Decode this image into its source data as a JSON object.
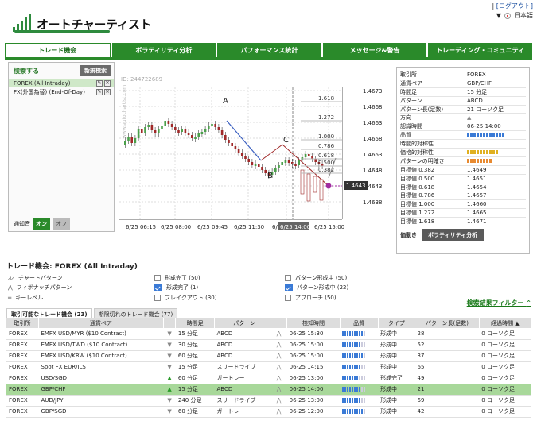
{
  "header": {
    "logo_text": "オートチャーティスト",
    "login_link": "[ログアウト]",
    "language": "日本語",
    "sep": "|"
  },
  "tabs": [
    "トレード機会",
    "ボラティリティ分析",
    "パフォーマンス統計",
    "メッセージ&警告",
    "トレーディング・コミュニティ"
  ],
  "search": {
    "title": "検索する",
    "new_button": "新規検索",
    "items": [
      "FOREX (All Intraday)",
      "FX(外国為替) (End-Of-Day)"
    ],
    "notify_label": "通知音",
    "on": "オン",
    "off": "オフ"
  },
  "chart_id": "ID: 244722689",
  "chart_data": {
    "type": "candlestick",
    "y_ticks": [
      "1.4673",
      "1.4668",
      "1.4663",
      "1.4658",
      "1.4653",
      "1.4648",
      "1.4643",
      "1.4638"
    ],
    "x_ticks": [
      "6/25 06:15",
      "6/25 08:00",
      "6/25 09:45",
      "6/25 11:30",
      "6/25 14:00",
      "6/25 15:00"
    ],
    "current_price": "1.4643",
    "fib_levels": [
      "1.618",
      "1.272",
      "1.000",
      "0.786",
      "0.618",
      "0.500",
      "0.382"
    ],
    "points": [
      "A",
      "B",
      "C"
    ],
    "watermark": "www.autochartist.com"
  },
  "info": {
    "rows": [
      {
        "k": "取引所",
        "v": "FOREX"
      },
      {
        "k": "通貨ペア",
        "v": "GBP/CHF"
      },
      {
        "k": "時間足",
        "v": "15 分足"
      },
      {
        "k": "パターン",
        "v": "ABCD"
      },
      {
        "k": "パターン長(足数)",
        "v": "21 ローソク足"
      },
      {
        "k": "方向",
        "v": "▲"
      },
      {
        "k": "認識時間",
        "v": "06-25 14:00"
      },
      {
        "k": "品質",
        "v": ""
      },
      {
        "k": "時間的対称性",
        "v": ""
      },
      {
        "k": "価格的対称性",
        "v": ""
      },
      {
        "k": "パターンの明確さ",
        "v": ""
      },
      {
        "k": "目標値 0.382",
        "v": "1.4649"
      },
      {
        "k": "目標値 0.500",
        "v": "1.4651"
      },
      {
        "k": "目標値 0.618",
        "v": "1.4654"
      },
      {
        "k": "目標値 0.786",
        "v": "1.4657"
      },
      {
        "k": "目標値 1.000",
        "v": "1.4660"
      },
      {
        "k": "目標値 1.272",
        "v": "1.4665"
      },
      {
        "k": "目標値 1.618",
        "v": "1.4671"
      }
    ],
    "footer_label": "価動き",
    "footer_button": "ボラティリティ分析"
  },
  "opportunities": {
    "title": "トレード機会: FOREX (All Intraday)",
    "legend": [
      "チャートパターン",
      "フィボナッチパターン",
      "キーレベル"
    ],
    "filters": [
      "形成完了 (50)",
      "形成完了 (1)",
      "ブレイクアウト (30)",
      "パターン形成中 (50)",
      "パターン形成中 (22)",
      "アプローチ (50)"
    ],
    "filter_link": "検索結果フィルター",
    "subtabs": [
      "取引可能なトレード機会 (23)",
      "期限切れのトレード機会 (77)"
    ],
    "columns": [
      "取引所",
      "通貨ペア",
      "",
      "時間足",
      "パターン",
      "",
      "検知時間",
      "品質",
      "タイプ",
      "パターン長(足数)",
      "経過時間 ▲"
    ],
    "rows": [
      {
        "ex": "FOREX",
        "pair": "EMFX USD/MYR ($10 Contract)",
        "dir": "▼",
        "tf": "15 分足",
        "pat": "ABCD",
        "t": "06-25 15:30",
        "q": 9,
        "type": "形成中",
        "len": "28",
        "age": "0 ローソク足"
      },
      {
        "ex": "FOREX",
        "pair": "EMFX USD/TWD ($10 Contract)",
        "dir": "▼",
        "tf": "30 分足",
        "pat": "ABCD",
        "t": "06-25 15:00",
        "q": 8,
        "type": "形成中",
        "len": "52",
        "age": "0 ローソク足"
      },
      {
        "ex": "FOREX",
        "pair": "EMFX USD/KRW ($10 Contract)",
        "dir": "▼",
        "tf": "60 分足",
        "pat": "ABCD",
        "t": "06-25 15:00",
        "q": 9,
        "type": "形成中",
        "len": "37",
        "age": "0 ローソク足"
      },
      {
        "ex": "FOREX",
        "pair": "Spot FX EUR/ILS",
        "dir": "▼",
        "tf": "15 分足",
        "pat": "スリードライブ",
        "t": "06-25 14:15",
        "q": 8,
        "type": "形成中",
        "len": "65",
        "age": "0 ローソク足"
      },
      {
        "ex": "FOREX",
        "pair": "USD/SGD",
        "dir": "▲",
        "tf": "60 分足",
        "pat": "ガートレー",
        "t": "06-25 13:00",
        "q": 7,
        "type": "形成完了",
        "len": "49",
        "age": "0 ローソク足"
      },
      {
        "ex": "FOREX",
        "pair": "GBP/CHF",
        "dir": "▲",
        "tf": "15 分足",
        "pat": "ABCD",
        "t": "06-25 14:00",
        "q": 8,
        "type": "形成中",
        "len": "21",
        "age": "0 ローソク足"
      },
      {
        "ex": "FOREX",
        "pair": "AUD/JPY",
        "dir": "▼",
        "tf": "240 分足",
        "pat": "スリードライブ",
        "t": "06-25 13:00",
        "q": 8,
        "type": "形成中",
        "len": "69",
        "age": "0 ローソク足"
      },
      {
        "ex": "FOREX",
        "pair": "GBP/SGD",
        "dir": "▼",
        "tf": "60 分足",
        "pat": "ガートレー",
        "t": "06-25 12:00",
        "q": 9,
        "type": "形成中",
        "len": "42",
        "age": "0 ローソク足"
      }
    ],
    "highlight_row": 5
  }
}
